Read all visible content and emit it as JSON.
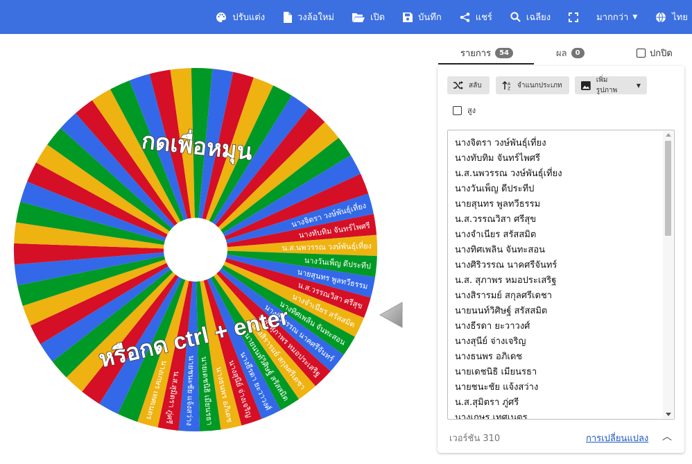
{
  "toolbar": {
    "items": [
      {
        "label": "ปรับแต่ง",
        "icon": "palette-icon"
      },
      {
        "label": "วงล้อใหม่",
        "icon": "file-icon"
      },
      {
        "label": "เปิด",
        "icon": "folder-open-icon"
      },
      {
        "label": "บันทึก",
        "icon": "save-icon"
      },
      {
        "label": "แชร์",
        "icon": "share-icon"
      },
      {
        "label": "เฉลียง",
        "icon": "search-icon"
      },
      {
        "label": "",
        "icon": "fullscreen-icon"
      },
      {
        "label": "มากกว่า",
        "icon": "caret-down-icon"
      },
      {
        "label": "ไทย",
        "icon": "globe-icon"
      }
    ]
  },
  "wheel": {
    "center_text_top": "กดเพื่อหมุน",
    "center_text_bottom": "หรือกด ctrl + enter",
    "colors": [
      "#3369e8",
      "#d50f25",
      "#eeb211",
      "#009925"
    ]
  },
  "tabs": {
    "entries_label": "รายการ",
    "entries_count": "54",
    "results_label": "ผล",
    "results_count": "0",
    "hide_label": "ปกปิด"
  },
  "panel": {
    "shuffle_label": "สลับ",
    "sort_label": "จำแนกประเภท",
    "add_image_label": "เพิ่มรูปภาพ",
    "advanced_label": "สูง",
    "entries": [
      "นางจิตรา วงษ์พันธุ์เที่ยง",
      "นางทับทิม จันทร์ไพศรี",
      "น.ส.นพวรรณ วงษ์พันธุ์เที่ยง",
      "นางวันเพ็ญ ดีประทีป",
      "นายสุนทร พูลทวีธรรม",
      "น.ส.วรรณวิสา ศรีสุข",
      "นางจำเนียร สรัสสมิต",
      "นางทิศเพลิน จันทะสอน",
      "นางศิริวรรณ นาคศรีจันทร์",
      "น.ส. สุภาพร หมอประเสริฐ",
      "นางสิรารมย์ สกุลศรีเดชา",
      "นายนนท์วิศิษฐ์ สรัสสมิต",
      "นางธีรดา ยะวาวงศ์",
      "นางสุนีย์ จ่างเจริญ",
      "นางธนพร อภิเดช",
      "นายเดชนิธิ เมียนรธา",
      "นายชนะชัย แจ้งสว่าง",
      "น.ส.สุมิตรา ภู่ศรี",
      "นางเกษร เทศเนตร"
    ],
    "version_text": "เวอร์ชัน 310",
    "changelog_label": "การเปลี่ยนแปลง"
  }
}
